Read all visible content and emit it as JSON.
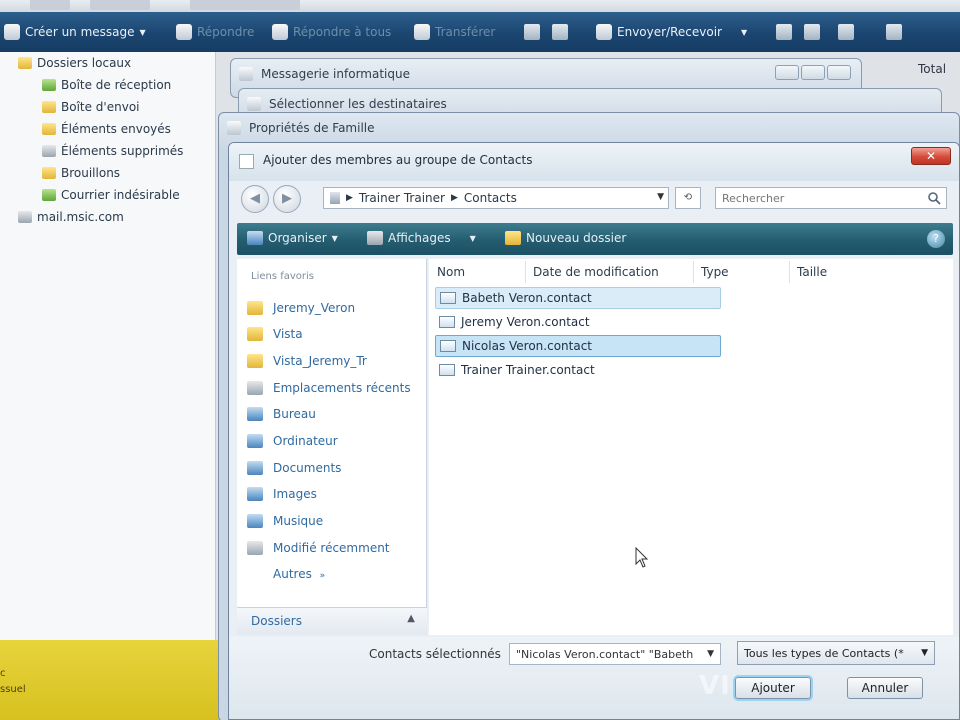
{
  "colors": {
    "toolbar": "#1b4570",
    "cmdbar": "#245c70",
    "selection": "#c7e3f6",
    "close": "#d44b3a"
  },
  "mail": {
    "toolbar": {
      "create_message": "Créer un message",
      "reply": "Répondre",
      "reply_all": "Répondre à tous",
      "forward": "Transférer",
      "send_receive": "Envoyer/Recevoir"
    },
    "folders": [
      {
        "label": "Dossiers locaux",
        "icon": "folder-icon"
      },
      {
        "label": "Boîte de réception",
        "icon": "inbox-icon"
      },
      {
        "label": "Boîte d'envoi",
        "icon": "outbox-icon"
      },
      {
        "label": "Éléments envoyés",
        "icon": "sent-icon"
      },
      {
        "label": "Éléments supprimés",
        "icon": "trash-icon"
      },
      {
        "label": "Brouillons",
        "icon": "drafts-icon"
      },
      {
        "label": "Courrier indésirable",
        "icon": "junk-icon"
      },
      {
        "label": "mail.msic.com",
        "icon": "server-icon"
      }
    ],
    "total_label": "Total",
    "strip_texts": [
      "c",
      "ssuel"
    ]
  },
  "windows": {
    "info_title": "Messagerie informatique",
    "select_title": "Sélectionner les destinataires",
    "props_title": "Propriétés de Famille"
  },
  "dialog": {
    "title": "Ajouter des membres au groupe de Contacts",
    "close": "✕",
    "nav": {
      "back": "◀",
      "forward": "▶"
    },
    "address": {
      "parts": [
        "Trainer Trainer",
        "Contacts"
      ]
    },
    "search_placeholder": "Rechercher",
    "refresh": "⟲",
    "commands": {
      "organize": "Organiser",
      "views": "Affichages",
      "new_folder": "Nouveau dossier"
    },
    "favorites_header": "Liens favoris",
    "nav_items": [
      {
        "label": "Jeremy_Veron",
        "icon": "folder-icon"
      },
      {
        "label": "Vista",
        "icon": "folder-icon"
      },
      {
        "label": "Vista_Jeremy_Tr",
        "icon": "folder-icon"
      },
      {
        "label": "Emplacements récents",
        "icon": "recent-places-icon"
      },
      {
        "label": "Bureau",
        "icon": "desktop-icon"
      },
      {
        "label": "Ordinateur",
        "icon": "computer-icon"
      },
      {
        "label": "Documents",
        "icon": "documents-icon"
      },
      {
        "label": "Images",
        "icon": "pictures-icon"
      },
      {
        "label": "Musique",
        "icon": "music-icon"
      },
      {
        "label": "Modifié récemment",
        "icon": "recent-changed-icon"
      }
    ],
    "more_label": "Autres",
    "folders_label": "Dossiers",
    "columns": [
      "Nom",
      "Date de modification",
      "Type",
      "Taille"
    ],
    "files": [
      {
        "name": "Babeth Veron.contact",
        "state": "hover"
      },
      {
        "name": "Jeremy Veron.contact",
        "state": "none"
      },
      {
        "name": "Nicolas Veron.contact",
        "state": "selected"
      },
      {
        "name": "Trainer Trainer.contact",
        "state": "none"
      }
    ],
    "selected_label": "Contacts sélectionnés",
    "selected_value": "\"Nicolas Veron.contact\" \"Babeth",
    "type_value": "Tous les types de Contacts (*",
    "ok": "Ajouter",
    "cancel": "Annuler",
    "watermark": "VIDE"
  }
}
